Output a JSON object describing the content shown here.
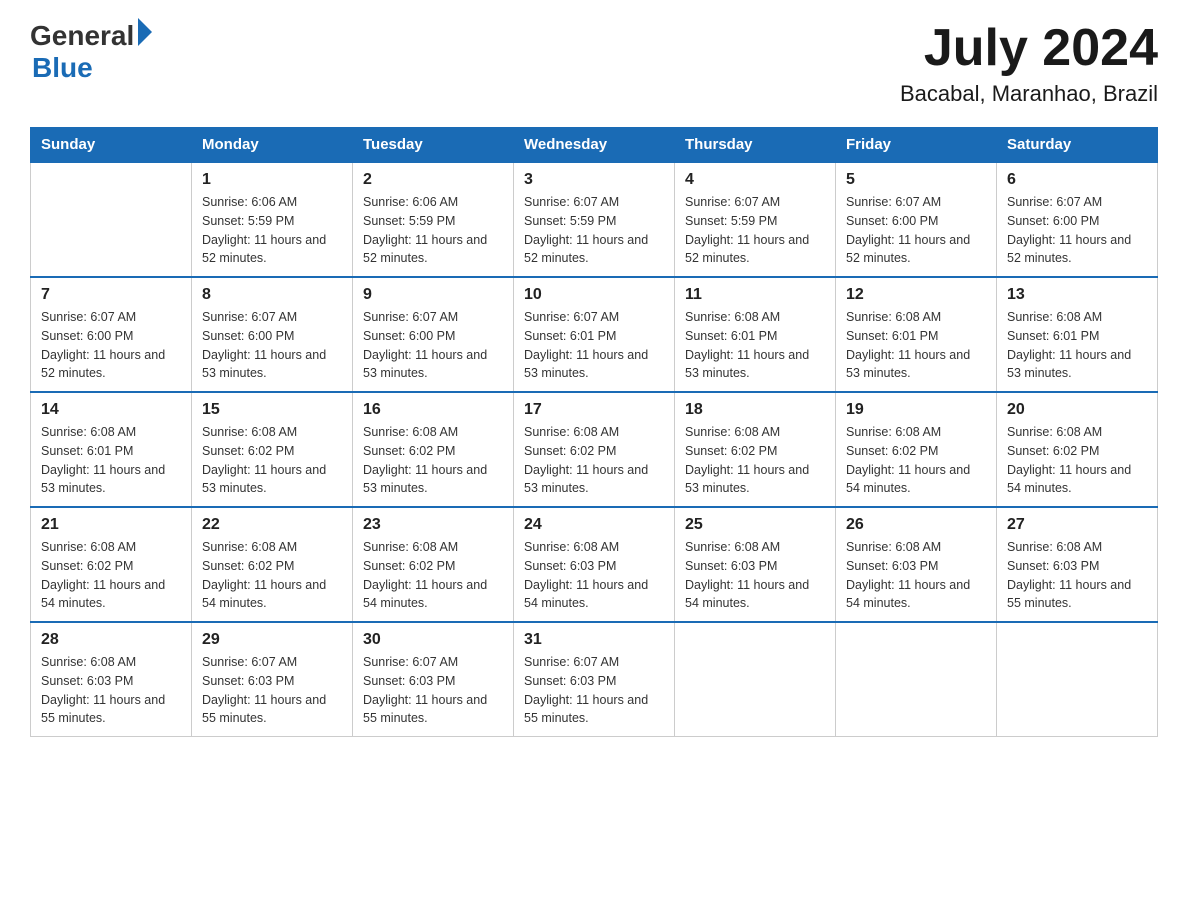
{
  "header": {
    "logo_general": "General",
    "logo_blue": "Blue",
    "month_year": "July 2024",
    "location": "Bacabal, Maranhao, Brazil"
  },
  "calendar": {
    "days_of_week": [
      "Sunday",
      "Monday",
      "Tuesday",
      "Wednesday",
      "Thursday",
      "Friday",
      "Saturday"
    ],
    "weeks": [
      [
        {
          "day": "",
          "detail": ""
        },
        {
          "day": "1",
          "detail": "Sunrise: 6:06 AM\nSunset: 5:59 PM\nDaylight: 11 hours\nand 52 minutes."
        },
        {
          "day": "2",
          "detail": "Sunrise: 6:06 AM\nSunset: 5:59 PM\nDaylight: 11 hours\nand 52 minutes."
        },
        {
          "day": "3",
          "detail": "Sunrise: 6:07 AM\nSunset: 5:59 PM\nDaylight: 11 hours\nand 52 minutes."
        },
        {
          "day": "4",
          "detail": "Sunrise: 6:07 AM\nSunset: 5:59 PM\nDaylight: 11 hours\nand 52 minutes."
        },
        {
          "day": "5",
          "detail": "Sunrise: 6:07 AM\nSunset: 6:00 PM\nDaylight: 11 hours\nand 52 minutes."
        },
        {
          "day": "6",
          "detail": "Sunrise: 6:07 AM\nSunset: 6:00 PM\nDaylight: 11 hours\nand 52 minutes."
        }
      ],
      [
        {
          "day": "7",
          "detail": "Sunrise: 6:07 AM\nSunset: 6:00 PM\nDaylight: 11 hours\nand 52 minutes."
        },
        {
          "day": "8",
          "detail": "Sunrise: 6:07 AM\nSunset: 6:00 PM\nDaylight: 11 hours\nand 53 minutes."
        },
        {
          "day": "9",
          "detail": "Sunrise: 6:07 AM\nSunset: 6:00 PM\nDaylight: 11 hours\nand 53 minutes."
        },
        {
          "day": "10",
          "detail": "Sunrise: 6:07 AM\nSunset: 6:01 PM\nDaylight: 11 hours\nand 53 minutes."
        },
        {
          "day": "11",
          "detail": "Sunrise: 6:08 AM\nSunset: 6:01 PM\nDaylight: 11 hours\nand 53 minutes."
        },
        {
          "day": "12",
          "detail": "Sunrise: 6:08 AM\nSunset: 6:01 PM\nDaylight: 11 hours\nand 53 minutes."
        },
        {
          "day": "13",
          "detail": "Sunrise: 6:08 AM\nSunset: 6:01 PM\nDaylight: 11 hours\nand 53 minutes."
        }
      ],
      [
        {
          "day": "14",
          "detail": "Sunrise: 6:08 AM\nSunset: 6:01 PM\nDaylight: 11 hours\nand 53 minutes."
        },
        {
          "day": "15",
          "detail": "Sunrise: 6:08 AM\nSunset: 6:02 PM\nDaylight: 11 hours\nand 53 minutes."
        },
        {
          "day": "16",
          "detail": "Sunrise: 6:08 AM\nSunset: 6:02 PM\nDaylight: 11 hours\nand 53 minutes."
        },
        {
          "day": "17",
          "detail": "Sunrise: 6:08 AM\nSunset: 6:02 PM\nDaylight: 11 hours\nand 53 minutes."
        },
        {
          "day": "18",
          "detail": "Sunrise: 6:08 AM\nSunset: 6:02 PM\nDaylight: 11 hours\nand 53 minutes."
        },
        {
          "day": "19",
          "detail": "Sunrise: 6:08 AM\nSunset: 6:02 PM\nDaylight: 11 hours\nand 54 minutes."
        },
        {
          "day": "20",
          "detail": "Sunrise: 6:08 AM\nSunset: 6:02 PM\nDaylight: 11 hours\nand 54 minutes."
        }
      ],
      [
        {
          "day": "21",
          "detail": "Sunrise: 6:08 AM\nSunset: 6:02 PM\nDaylight: 11 hours\nand 54 minutes."
        },
        {
          "day": "22",
          "detail": "Sunrise: 6:08 AM\nSunset: 6:02 PM\nDaylight: 11 hours\nand 54 minutes."
        },
        {
          "day": "23",
          "detail": "Sunrise: 6:08 AM\nSunset: 6:02 PM\nDaylight: 11 hours\nand 54 minutes."
        },
        {
          "day": "24",
          "detail": "Sunrise: 6:08 AM\nSunset: 6:03 PM\nDaylight: 11 hours\nand 54 minutes."
        },
        {
          "day": "25",
          "detail": "Sunrise: 6:08 AM\nSunset: 6:03 PM\nDaylight: 11 hours\nand 54 minutes."
        },
        {
          "day": "26",
          "detail": "Sunrise: 6:08 AM\nSunset: 6:03 PM\nDaylight: 11 hours\nand 54 minutes."
        },
        {
          "day": "27",
          "detail": "Sunrise: 6:08 AM\nSunset: 6:03 PM\nDaylight: 11 hours\nand 55 minutes."
        }
      ],
      [
        {
          "day": "28",
          "detail": "Sunrise: 6:08 AM\nSunset: 6:03 PM\nDaylight: 11 hours\nand 55 minutes."
        },
        {
          "day": "29",
          "detail": "Sunrise: 6:07 AM\nSunset: 6:03 PM\nDaylight: 11 hours\nand 55 minutes."
        },
        {
          "day": "30",
          "detail": "Sunrise: 6:07 AM\nSunset: 6:03 PM\nDaylight: 11 hours\nand 55 minutes."
        },
        {
          "day": "31",
          "detail": "Sunrise: 6:07 AM\nSunset: 6:03 PM\nDaylight: 11 hours\nand 55 minutes."
        },
        {
          "day": "",
          "detail": ""
        },
        {
          "day": "",
          "detail": ""
        },
        {
          "day": "",
          "detail": ""
        }
      ]
    ]
  }
}
